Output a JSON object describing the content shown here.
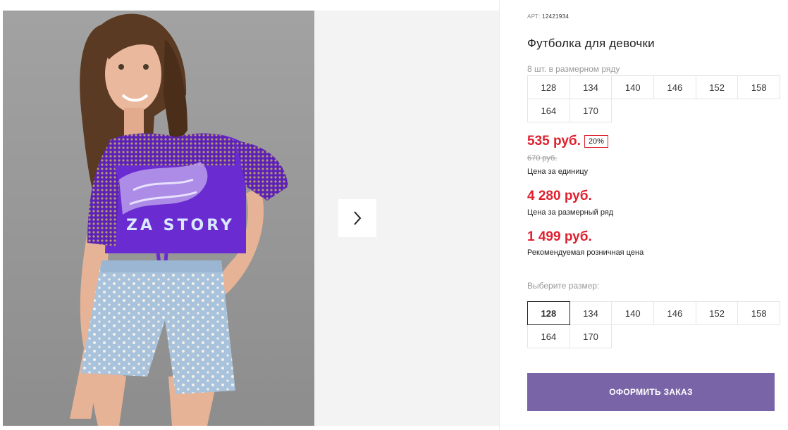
{
  "product": {
    "sku_prefix": "АРТ:",
    "sku": "12421934",
    "title": "Футболка для девочки",
    "image_alt": "Девочка в фиолетовой футболке с сетчатыми рукавами и джинсовых шортах",
    "shirt_print_text": "ZA STORY"
  },
  "pack": {
    "label": "8 шт. в размерном ряду",
    "sizes": [
      "128",
      "134",
      "140",
      "146",
      "152",
      "158",
      "164",
      "170"
    ]
  },
  "prices": {
    "unit_price": "535 руб.",
    "discount": "20%",
    "old_price": "670 руб.",
    "unit_label": "Цена за единицу",
    "pack_price": "4 280 руб.",
    "pack_label": "Цена за размерный ряд",
    "retail_price": "1 499 руб.",
    "retail_label": "Рекомендуемая розничная цена"
  },
  "size_select": {
    "label": "Выберите размер:",
    "sizes": [
      "128",
      "134",
      "140",
      "146",
      "152",
      "158",
      "164",
      "170"
    ],
    "selected": "128"
  },
  "order_button": "ОФОРМИТЬ ЗАКАЗ",
  "colors": {
    "price_red": "#e0202f",
    "button_purple": "#7a64a8",
    "shirt_purple": "#6a2bd0",
    "denim": "#a9c3dc"
  },
  "icons": {
    "gallery_next": "chevron-right-icon"
  }
}
